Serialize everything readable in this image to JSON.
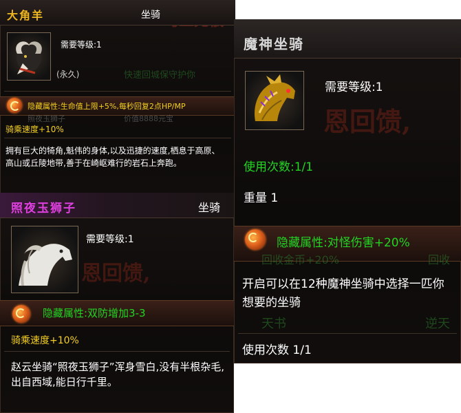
{
  "panel_a": {
    "title": "大角羊",
    "type": "坐骑",
    "bg_banner": "马上无俄",
    "level_req": "需要等级:1",
    "duration": "(永久)",
    "bg_ghost_1": "快速回城保守护你",
    "bg_ghost_2": "照夜玉狮子",
    "bg_ghost_3": "价值8888元宝",
    "hidden_attr": "隐藏属性:生命值上限+5%,每秒回复2点HP/MP",
    "ride_speed": "骑乘速度+10%",
    "description": "拥有巨大的犄角,魁伟的身体,以及迅捷的速度,栖息于高原、高山或丘陵地带,善于在崎岖难行的岩石上奔跑。"
  },
  "panel_b": {
    "title": "照夜玉狮子",
    "type": "坐骑",
    "level_req": "需要等级:1",
    "bg_banner": "恩回馈,",
    "hidden_attr": "隐藏属性:双防增加3-3",
    "ride_speed": "骑乘速度+10%",
    "description": "赵云坐骑“照夜玉狮子”浑身雪白,没有半根杂毛,出自西域,能日行千里。"
  },
  "panel_c": {
    "title": "魔神坐骑",
    "level_req": "需要等级:1",
    "bg_banner": "恩回馈,",
    "use_count": "使用次数:1/1",
    "weight": "重量 1",
    "hidden_attr": "隐藏属性:对怪伤害+20%",
    "bg_ghost_1": "回收金币+20%",
    "bg_ghost_2": "回收",
    "description": "开启可以在12种魔神坐骑中选择一匹你想要的坐骑",
    "bg_ghost_3": "天书",
    "bg_ghost_4": "逆天",
    "use_count_footer": "使用次数 1/1"
  },
  "colors": {
    "green": "#23d423",
    "yellow": "#f5d020",
    "gold_title": "#f0b820",
    "pink_title": "#e040e0"
  },
  "icons": [
    "ram-horns-item-icon",
    "white-horse-item-icon",
    "golden-dragon-item-icon",
    "dragon-emblem-icon"
  ]
}
